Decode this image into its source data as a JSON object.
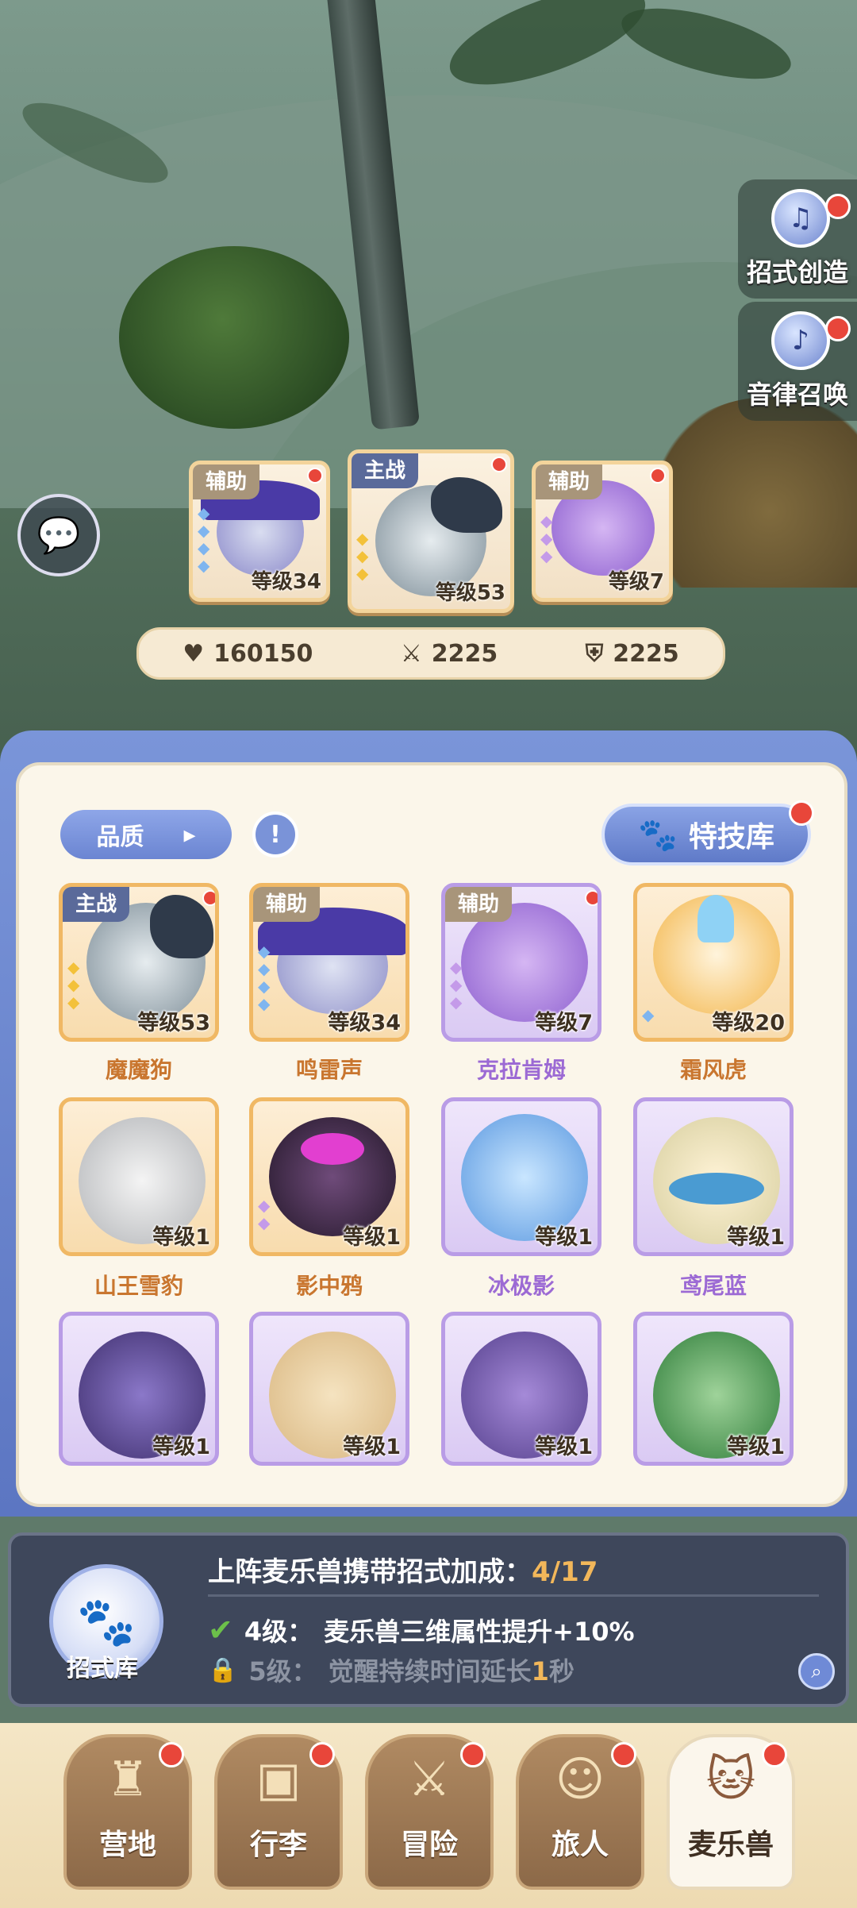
{
  "side_buttons": [
    {
      "label": "招式创造",
      "icon": "skill-create-icon"
    },
    {
      "label": "音律召唤",
      "icon": "music-summon-icon"
    }
  ],
  "team": [
    {
      "role": "辅助",
      "level": "等级34"
    },
    {
      "role": "主战",
      "level": "等级53"
    },
    {
      "role": "辅助",
      "level": "等级7"
    }
  ],
  "stats": {
    "hp": "160150",
    "attack": "2225",
    "defense": "2225"
  },
  "panel": {
    "filter_label": "品质",
    "info_label": "!",
    "skill_library_label": "特技库"
  },
  "pets": [
    {
      "name": "魔魔狗",
      "level": "等级53",
      "tag": "主战"
    },
    {
      "name": "鸣雷声",
      "level": "等级34",
      "tag": "辅助"
    },
    {
      "name": "克拉肯姆",
      "level": "等级7",
      "tag": "辅助"
    },
    {
      "name": "霜风虎",
      "level": "等级20",
      "tag": ""
    },
    {
      "name": "山王雪豹",
      "level": "等级1",
      "tag": ""
    },
    {
      "name": "影中鸦",
      "level": "等级1",
      "tag": ""
    },
    {
      "name": "冰极影",
      "level": "等级1",
      "tag": ""
    },
    {
      "name": "鸢尾蓝",
      "level": "等级1",
      "tag": ""
    },
    {
      "name": "",
      "level": "等级1",
      "tag": ""
    },
    {
      "name": "",
      "level": "等级1",
      "tag": ""
    },
    {
      "name": "",
      "level": "等级1",
      "tag": ""
    },
    {
      "name": "",
      "level": "等级1",
      "tag": ""
    }
  ],
  "bonus": {
    "library_label": "招式库",
    "title": "上阵麦乐兽携带招式加成：",
    "progress": "4/17",
    "row1_level": "4级：",
    "row1_text": "麦乐兽三维属性提升+10%",
    "row2_level": "5级：",
    "row2_text_a": "觉醒持续时间延长",
    "row2_highlight": "1",
    "row2_text_b": "秒"
  },
  "nav": [
    {
      "label": "营地",
      "icon": "castle-icon"
    },
    {
      "label": "行李",
      "icon": "bag-icon"
    },
    {
      "label": "冒险",
      "icon": "swords-icon"
    },
    {
      "label": "旅人",
      "icon": "traveler-icon"
    },
    {
      "label": "麦乐兽",
      "icon": "pet-icon"
    }
  ],
  "colors": {
    "accent": "#6b85d2",
    "highlight": "#f2b75a",
    "alert": "#e8463a"
  }
}
